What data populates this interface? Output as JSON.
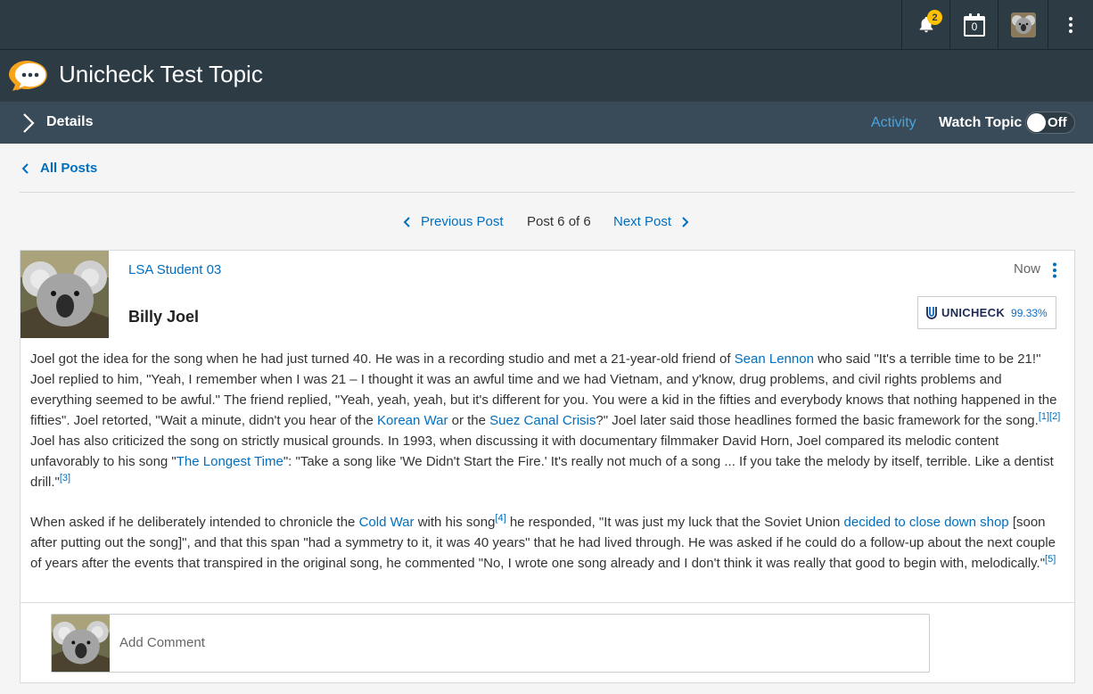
{
  "topbar": {
    "notifications_count": "2",
    "calendar_count": "0"
  },
  "header": {
    "title": "Unicheck Test Topic"
  },
  "subbar": {
    "details_label": "Details",
    "activity_label": "Activity",
    "watch_label": "Watch Topic",
    "watch_state": "Off"
  },
  "nav": {
    "all_posts": "All Posts",
    "previous": "Previous Post",
    "position": "Post 6 of 6",
    "next": "Next Post"
  },
  "post": {
    "author": "LSA Student 03",
    "time": "Now",
    "title": "Billy Joel",
    "unicheck_brand": "UNICHECK",
    "unicheck_score": "99.33%",
    "p1": {
      "t1": "Joel got the idea for the song when he had just turned 40. He was in a recording studio and met a 21-year-old friend of ",
      "l1": "Sean Lennon",
      "t2": " who said \"It's a terrible time to be 21!\" Joel replied to him, \"Yeah, I remember when I was 21 – I thought it was an awful time and we had Vietnam, and y'know, drug problems, and civil rights problems and everything seemed to be awful.\" The friend replied, \"Yeah, yeah, yeah, but it's different for you. You were a kid in the fifties and everybody knows that nothing happened in the fifties\". Joel retorted, \"Wait a minute, didn't you hear of the ",
      "l2": "Korean War",
      "t3": " or the ",
      "l3": "Suez Canal Crisis",
      "t4": "?\" Joel later said those headlines formed the basic framework for the song.",
      "s1": "[1][2]",
      "t5": " Joel has also criticized the song on strictly musical grounds. In 1993, when discussing it with documentary filmmaker David Horn, Joel compared its melodic content unfavorably to his song \"",
      "l4": "The Longest Time",
      "t6": "\": \"Take a song like 'We Didn't Start the Fire.' It's really not much of a song ... If you take the melody by itself, terrible. Like a dentist drill.\"",
      "s2": "[3]"
    },
    "p2": {
      "t1": "When asked if he deliberately intended to chronicle the ",
      "l1": "Cold War",
      "t2": " with his song",
      "s1": "[4]",
      "t3": " he responded, \"It was just my luck that the Soviet Union ",
      "l2": "decided to close down shop",
      "t4": " [soon after putting out the song]\", and that this span \"had a symmetry to it, it was 40 years\" that he had lived through. He was asked if he could do a follow-up about the next couple of years after the events that transpired in the original song, he commented \"No, I wrote one song already and I don't think it was really that good to begin with, melodically.\"",
      "s2": "[5]"
    }
  },
  "comment": {
    "placeholder": "Add Comment"
  }
}
